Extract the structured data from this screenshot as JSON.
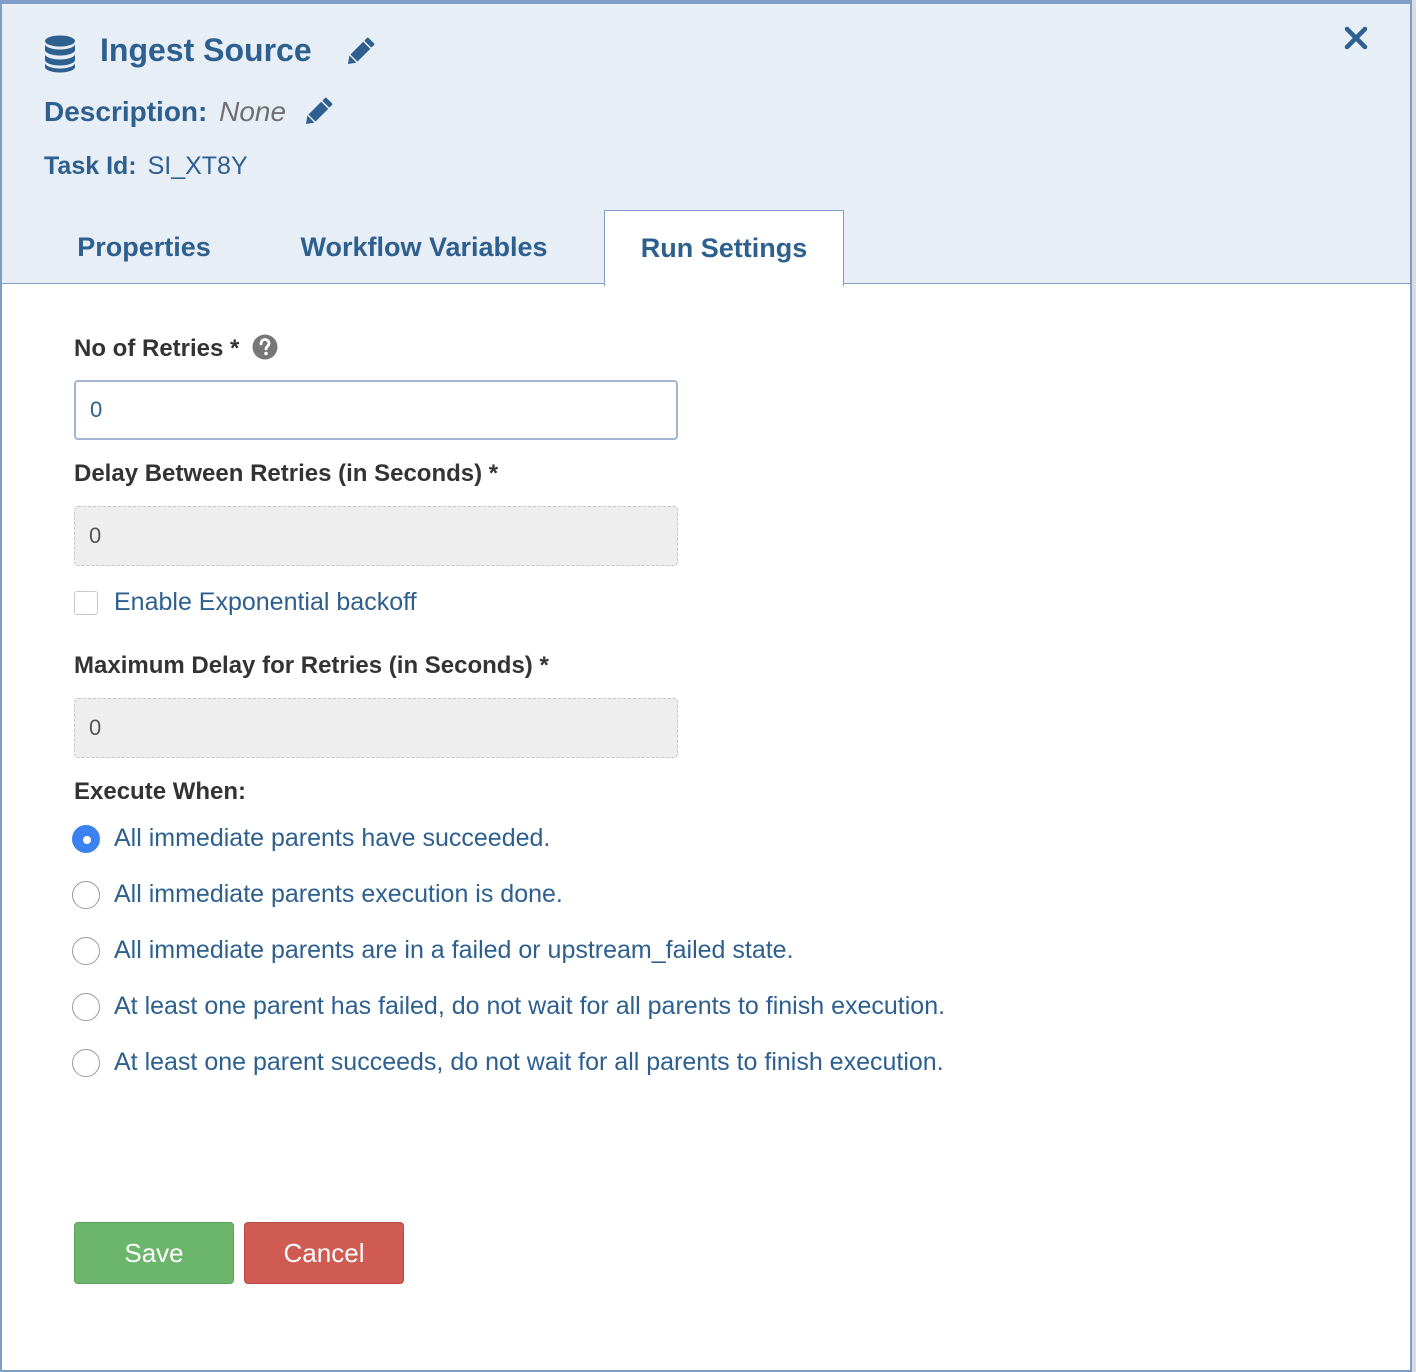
{
  "header": {
    "title": "Ingest Source",
    "description_label": "Description:",
    "description_value": "None",
    "task_id_label": "Task Id:",
    "task_id_value": "SI_XT8Y",
    "icons": {
      "source": "database-icon",
      "edit": "pencil-icon",
      "close": "close-icon"
    }
  },
  "tabs": [
    {
      "label": "Properties",
      "active": false
    },
    {
      "label": "Workflow Variables",
      "active": false
    },
    {
      "label": "Run Settings",
      "active": true
    }
  ],
  "form": {
    "retries_label": "No of Retries *",
    "retries_value": "0",
    "delay_label": "Delay Between Retries (in Seconds) *",
    "delay_value": "0",
    "backoff_label": "Enable Exponential backoff",
    "backoff_checked": false,
    "max_delay_label": "Maximum Delay for Retries (in Seconds) *",
    "max_delay_value": "0",
    "execute_when_label": "Execute When:",
    "execute_options": [
      {
        "label": "All immediate parents have succeeded.",
        "selected": true
      },
      {
        "label": "All immediate parents execution is done.",
        "selected": false
      },
      {
        "label": "All immediate parents are in a failed or upstream_failed state.",
        "selected": false
      },
      {
        "label": "At least one parent has failed, do not wait for all parents to finish execution.",
        "selected": false
      },
      {
        "label": "At least one parent succeeds, do not wait for all parents to finish execution.",
        "selected": false
      }
    ]
  },
  "buttons": {
    "save": "Save",
    "cancel": "Cancel"
  },
  "colors": {
    "accent": "#2d5f8f",
    "header_bg": "#e8eef6",
    "save": "#6cb66b",
    "cancel": "#cf5b53",
    "radio_selected": "#3b82f0"
  }
}
